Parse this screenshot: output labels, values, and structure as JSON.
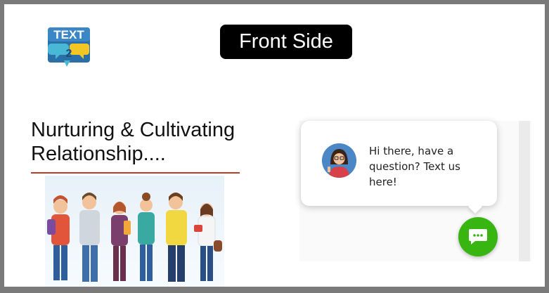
{
  "logo": {
    "text": "TEXT",
    "icon": "text2-logo-icon"
  },
  "header": {
    "title": "Front Side"
  },
  "main": {
    "heading": "Nurturing & Cultivating Relationship...."
  },
  "illustration": {
    "icon": "group-of-students-illustration"
  },
  "chat_widget": {
    "message": "Hi there, have a question? Text us here!",
    "avatar_icon": "agent-avatar-icon",
    "button_icon": "chat-bubble-icon"
  },
  "colors": {
    "pill_bg": "#000000",
    "accent_rule": "#c0392b",
    "chat_button": "#39b512",
    "avatar_bg": "#4b86c6"
  }
}
